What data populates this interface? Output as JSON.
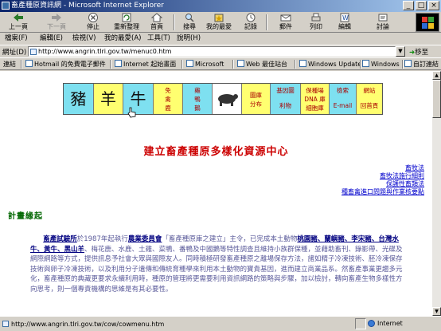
{
  "window": {
    "title": "畜產種原資訊網 - Microsoft Internet Explorer",
    "buttons": [
      "_",
      "□",
      "×"
    ]
  },
  "toolbar": [
    {
      "label": "上一頁",
      "icon": "back-arrow-icon"
    },
    {
      "label": "下一頁",
      "icon": "forward-arrow-icon"
    },
    {
      "label": "停止",
      "icon": "stop-icon"
    },
    {
      "label": "重新整理",
      "icon": "refresh-icon"
    },
    {
      "label": "首頁",
      "icon": "home-icon"
    },
    {
      "label": "搜尋",
      "icon": "search-icon"
    },
    {
      "label": "我的最愛",
      "icon": "favorites-icon"
    },
    {
      "label": "記錄",
      "icon": "history-icon"
    },
    {
      "label": "郵件",
      "icon": "mail-icon"
    },
    {
      "label": "列印",
      "icon": "print-icon"
    },
    {
      "label": "編輯",
      "icon": "edit-icon"
    },
    {
      "label": "討論",
      "icon": "discuss-icon"
    }
  ],
  "menu": [
    "檔案(F)",
    "編輯(E)",
    "檢視(V)",
    "我的最愛(A)",
    "工具(T)",
    "說明(H)"
  ],
  "address": {
    "label": "網址(D)",
    "url": "http://www.angrin.tlri.gov.tw/menuc0.htm",
    "go": "移至"
  },
  "links": {
    "label": "連結",
    "items": [
      "Hotmail 的免費電子郵件",
      "Internet 起始畫面",
      "Microsoft",
      "Web 最佳站台",
      "Windows Update",
      "Windows",
      "自訂連結"
    ]
  },
  "nav": {
    "animals": [
      "豬",
      "羊",
      "牛"
    ],
    "cells": [
      {
        "lines": [
          "免",
          "禽",
          "鹿"
        ]
      },
      {
        "lines": [
          "雞",
          "鴨",
          "鵝"
        ]
      },
      {
        "lines": [
          "圖庫",
          "分布"
        ]
      },
      {
        "lines": [
          "基因圖",
          "利物"
        ]
      },
      {
        "lines": [
          "保種場",
          "DNA 庫",
          "細胞庫"
        ]
      },
      {
        "lines": [
          "檢索",
          "E-mail"
        ]
      },
      {
        "lines": [
          "網站",
          "回首頁"
        ]
      }
    ]
  },
  "page": {
    "heading": "建立畜產種原多樣化資源中心",
    "right_links": [
      "畜牧法",
      "畜牧法施行細則",
      "保護性畜類法",
      "種畜禽進口問題與作業核要點"
    ],
    "section_title": "計畫緣起",
    "paragraph": {
      "p1": "畜產試驗所",
      "p2": "於1987年起執行",
      "p3": "農業委員會",
      "p4": "「畜產種原庫之建立」主令，已完成本土動物",
      "p5": "桃園豬、蘭嶼豬、李宋豬、台灣水牛、黃牛、黑山羊",
      "p6": "、梅花鹿、水鹿、土雞、菜鴨、番鴨及中國鵝等特性調查且維持小族群保種，並藉助畜刊、錄影帶、光碟及網際網路等方式，提供訊息予社會大眾與國際友人。同時積極研發畜產種原之離場保存方法，諸如精子冷凍技術、胚冷凍保存技術與卵子冷凍技術，以及利用分子遺傳和傳統育種學來利用本土動物的寶貴基因，進而建立商業品系。然畜產事業更趨多元化，畜產種原的典藏更要求永續利用時，種原的管理將更需要利用資訊網路的策略與步驟，加以檢討，轉向畜產生物多樣性方向思考，則一個專責機構的思維是有其必要性。"
    }
  },
  "status": {
    "text": "http://www.angrin.tlri.gov.tw/cow/cowmenu.htm",
    "zone": "Internet"
  }
}
